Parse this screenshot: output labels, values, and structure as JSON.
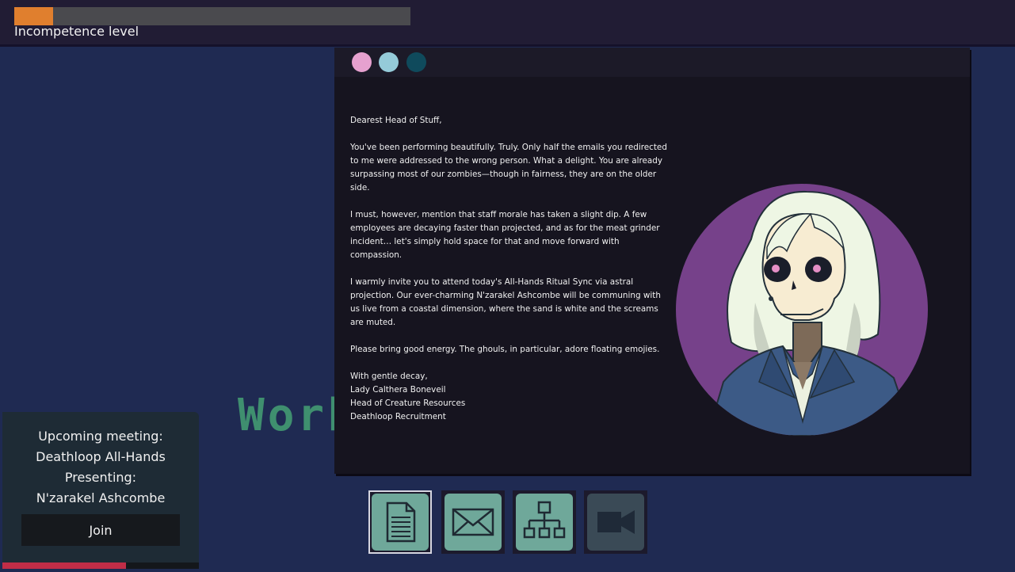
{
  "hud": {
    "incompetence_label": "Incompetence level",
    "incompetence_fraction": 0.098,
    "meter_color": "#e07f2e"
  },
  "background": {
    "word": "Work"
  },
  "mail_window": {
    "controls": [
      {
        "name": "window-dot-pink",
        "color": "#e6a1cf"
      },
      {
        "name": "window-dot-lightblue",
        "color": "#95cbd9"
      },
      {
        "name": "window-dot-teal",
        "color": "#0f4a5c"
      }
    ],
    "greeting": "Dearest Head of Stuff,",
    "paragraphs": [
      "You've been performing beautifully. Truly. Only half the emails you redirected to me were addressed to the wrong person. What a delight. You are already surpassing most of our zombies—though in fairness, they are on the older side.",
      "I must, however, mention that staff morale has taken a slight dip. A few employees are decaying faster than projected, and as for the meat grinder incident… let's simply hold space for that and move forward with compassion.",
      "I warmly invite you to attend today's All-Hands Ritual Sync via astral projection. Our ever-charming N'zarakel Ashcombe will be communing with us live from a coastal dimension, where the sand is white and the screams are muted.",
      "Please bring good energy. The ghouls, in particular, adore floating emojies."
    ],
    "signoff": "With gentle decay,",
    "sender_name": "Lady Calthera Boneveil",
    "sender_title": "Head of Creature Resources",
    "sender_company": "Deathloop Recruitment"
  },
  "meeting": {
    "label": "Upcoming meeting:",
    "title": "Deathloop All-Hands",
    "presenting_label": "Presenting:",
    "presenter": "N'zarakel Ashcombe",
    "join_label": "Join",
    "time_remaining_fraction": 0.63,
    "timer_color": "#c12d47"
  },
  "dock": {
    "items": [
      {
        "name": "document-app",
        "icon": "document-icon",
        "selected": true,
        "enabled": true
      },
      {
        "name": "mail-app",
        "icon": "envelope-icon",
        "selected": false,
        "enabled": true
      },
      {
        "name": "org-chart-app",
        "icon": "org-chart-icon",
        "selected": false,
        "enabled": true
      },
      {
        "name": "video-call-app",
        "icon": "video-camera-icon",
        "selected": false,
        "enabled": false
      }
    ]
  }
}
